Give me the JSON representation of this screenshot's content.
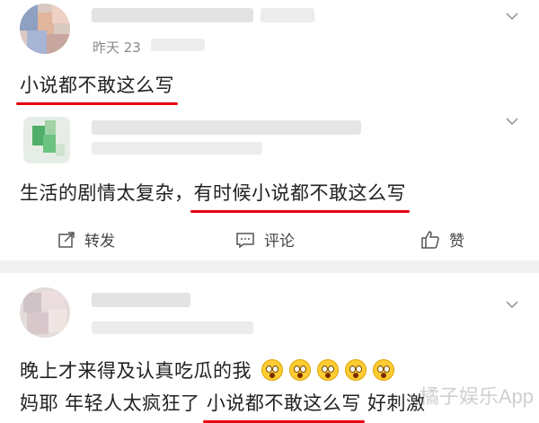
{
  "comment1": {
    "time": "昨天 23",
    "text": "小说都不敢这么写"
  },
  "comment2": {
    "text_plain": "生活的剧情太复杂，",
    "text_highlight": "有时候小说都不敢这么写"
  },
  "actions": {
    "repost": "转发",
    "comment": "评论",
    "like": "赞"
  },
  "comment3": {
    "line1": "晚上才来得及认真吃瓜的我",
    "line2_plain": "妈耶 年轻人太疯狂了 ",
    "line2_highlight": "小说都不敢这么写",
    "line2_end": " 好刺激",
    "emoji_count": 5
  },
  "watermark": "橘子娱乐App",
  "icons": {
    "repost": "repost-icon",
    "comment": "comment-icon",
    "like": "thumbs-up-icon",
    "menu": "chevron-down-icon"
  },
  "colors": {
    "highlight_line": "#e60012",
    "divider": "#f1f1f1",
    "emoji": "#ffcc33"
  }
}
